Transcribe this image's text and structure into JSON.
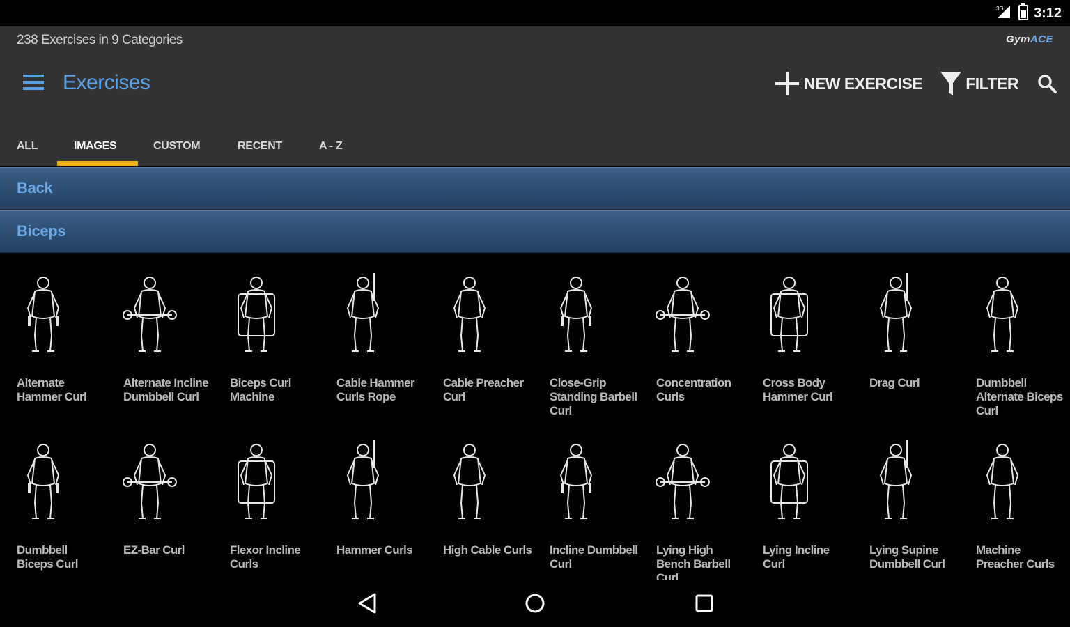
{
  "status_bar": {
    "time": "3:12",
    "signal_label": "3G"
  },
  "header": {
    "count_text": "238 Exercises in 9 Categories",
    "brand_prefix": "Gym",
    "brand_suffix": "ACE",
    "title": "Exercises",
    "actions": {
      "new_exercise": "NEW EXERCISE",
      "filter": "FILTER"
    }
  },
  "tabs": [
    {
      "label": "ALL",
      "active": false
    },
    {
      "label": "IMAGES",
      "active": true
    },
    {
      "label": "CUSTOM",
      "active": false
    },
    {
      "label": "RECENT",
      "active": false
    },
    {
      "label": "A - Z",
      "active": false
    }
  ],
  "sections": {
    "back": "Back",
    "category": "Biceps"
  },
  "exercises": [
    {
      "name": "Alternate Hammer Curl"
    },
    {
      "name": "Alternate Incline Dumbbell Curl"
    },
    {
      "name": "Biceps Curl Machine"
    },
    {
      "name": "Cable Hammer Curls Rope"
    },
    {
      "name": "Cable Preacher Curl"
    },
    {
      "name": "Close-Grip Standing Barbell Curl"
    },
    {
      "name": "Concentration Curls"
    },
    {
      "name": "Cross Body Hammer Curl"
    },
    {
      "name": "Drag Curl"
    },
    {
      "name": "Dumbbell Alternate Biceps Curl"
    },
    {
      "name": "Dumbbell Biceps Curl"
    },
    {
      "name": "EZ-Bar Curl"
    },
    {
      "name": "Flexor Incline Curls"
    },
    {
      "name": "Hammer Curls"
    },
    {
      "name": "High Cable Curls"
    },
    {
      "name": "Incline Dumbbell Curl"
    },
    {
      "name": "Lying High Bench Barbell Curl"
    },
    {
      "name": "Lying Incline Curl"
    },
    {
      "name": "Lying Supine Dumbbell Curl"
    },
    {
      "name": "Machine Preacher Curls"
    }
  ],
  "colors": {
    "accent_blue": "#5aa0e6",
    "tab_indicator": "#f4b01a",
    "appbar": "#333333"
  }
}
